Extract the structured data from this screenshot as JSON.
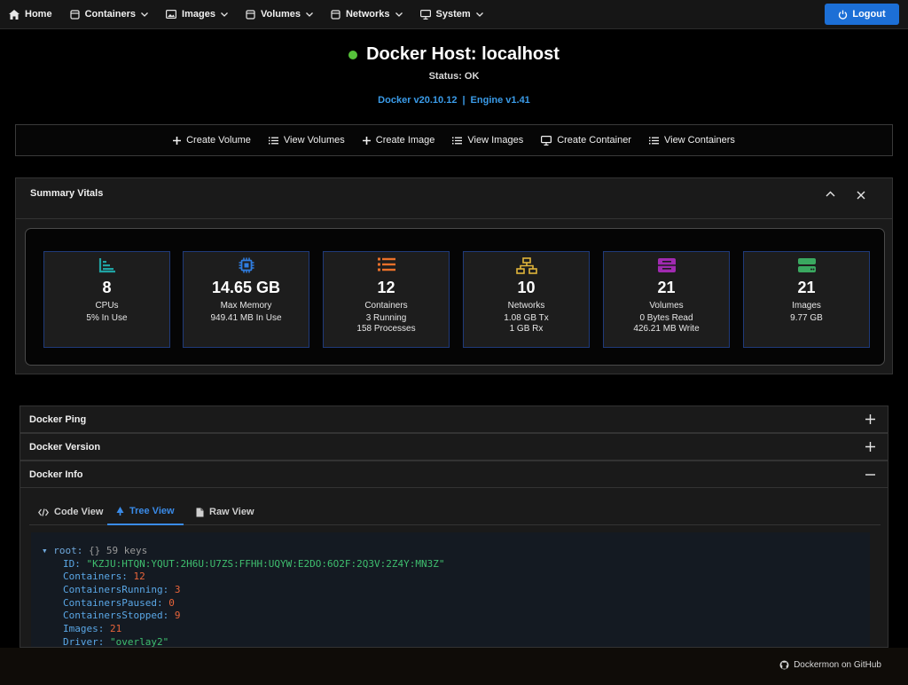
{
  "nav": {
    "items": [
      {
        "label": "Home",
        "icon": "home-icon"
      },
      {
        "label": "Containers",
        "icon": "container-icon"
      },
      {
        "label": "Images",
        "icon": "image-icon"
      },
      {
        "label": "Volumes",
        "icon": "volume-icon"
      },
      {
        "label": "Networks",
        "icon": "network-icon"
      },
      {
        "label": "System",
        "icon": "monitor-icon"
      }
    ],
    "logout_label": "Logout"
  },
  "host": {
    "title": "Docker Host: localhost",
    "status": "Status: OK",
    "status_color": "#56c23b",
    "docker_version": "Docker v20.10.12",
    "separator": "|",
    "engine_version": "Engine v1.41"
  },
  "actions": [
    {
      "label": "Create Volume",
      "icon": "plus-icon"
    },
    {
      "label": "View Volumes",
      "icon": "list-icon"
    },
    {
      "label": "Create Image",
      "icon": "plus-icon"
    },
    {
      "label": "View Images",
      "icon": "list-icon"
    },
    {
      "label": "Create Container",
      "icon": "monitor-icon"
    },
    {
      "label": "View Containers",
      "icon": "list-icon"
    }
  ],
  "summary": {
    "title": "Summary Vitals",
    "vitals": [
      {
        "value": "8",
        "label": "CPUs",
        "sub1": "5% In Use",
        "sub2": "",
        "icon": "chart-icon",
        "color": "#20a3a3"
      },
      {
        "value": "14.65 GB",
        "label": "Max Memory",
        "sub1": "949.41 MB In Use",
        "sub2": "",
        "icon": "chip-icon",
        "color": "#2f7de0"
      },
      {
        "value": "12",
        "label": "Containers",
        "sub1": "3 Running",
        "sub2": "158 Processes",
        "icon": "list-icon",
        "color": "#e8702a"
      },
      {
        "value": "10",
        "label": "Networks",
        "sub1": "1.08 GB Tx",
        "sub2": "1 GB Rx",
        "icon": "network-icon",
        "color": "#e0b43a"
      },
      {
        "value": "21",
        "label": "Volumes",
        "sub1": "0 Bytes Read",
        "sub2": "426.21 MB Write",
        "icon": "drive-icon",
        "color": "#a02ab0"
      },
      {
        "value": "21",
        "label": "Images",
        "sub1": "9.77 GB",
        "sub2": "",
        "icon": "storage-icon",
        "color": "#3aa860"
      }
    ]
  },
  "accordions": {
    "ping": "Docker Ping",
    "version": "Docker Version",
    "info": "Docker Info"
  },
  "tabs": [
    {
      "label": "Code View",
      "icon": "code-icon"
    },
    {
      "label": "Tree View",
      "icon": "tree-icon"
    },
    {
      "label": "Raw View",
      "icon": "file-icon"
    }
  ],
  "tree": {
    "root_label": "root:",
    "root_braces": "{}",
    "root_count": "59 keys",
    "entries": [
      {
        "key": "ID:",
        "value": "\"KZJU:HTQN:YQUT:2H6U:U7ZS:FFHH:UQYW:E2DO:6O2F:2Q3V:2Z4Y:MN3Z\"",
        "kind": "str"
      },
      {
        "key": "Containers:",
        "value": "12",
        "kind": "num"
      },
      {
        "key": "ContainersRunning:",
        "value": "3",
        "kind": "num"
      },
      {
        "key": "ContainersPaused:",
        "value": "0",
        "kind": "num"
      },
      {
        "key": "ContainersStopped:",
        "value": "9",
        "kind": "num"
      },
      {
        "key": "Images:",
        "value": "21",
        "kind": "num"
      },
      {
        "key": "Driver:",
        "value": "\"overlay2\"",
        "kind": "str"
      }
    ]
  },
  "footer": {
    "github_label": "Dockermon on GitHub"
  }
}
